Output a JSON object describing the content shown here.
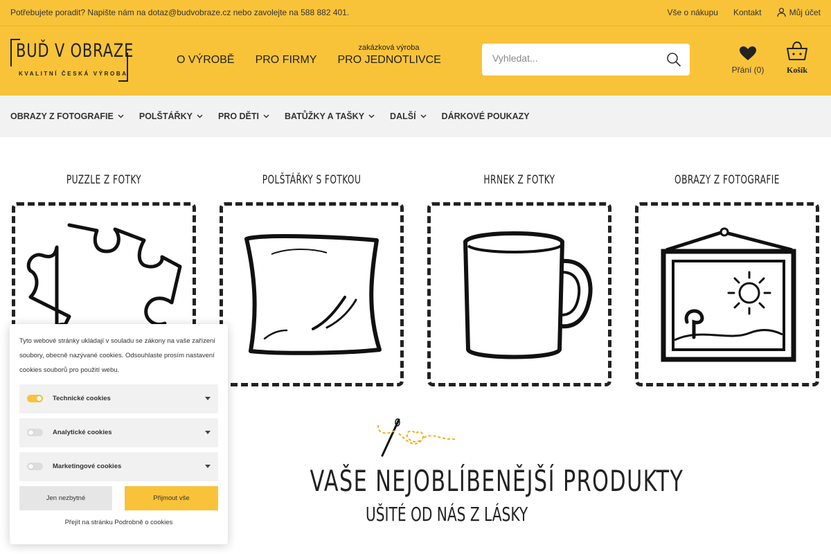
{
  "topbar": {
    "message": "Potřebujete poradit? Napište nám na dotaz@budvobraze.cz nebo zavolejte na 588 882 401.",
    "links": [
      "Vše o nákupu",
      "Kontakt"
    ],
    "account": "Můj účet"
  },
  "logo": {
    "brand": "BUĎ V OBRAZE",
    "tagline": "KVALITNÍ ČESKÁ VÝROBA"
  },
  "mainnav": {
    "items": [
      "O VÝROBĚ",
      "PRO FIRMY",
      "PRO JEDNOTLIVCE"
    ],
    "jednotlivce_small": "zakázková výroba"
  },
  "search": {
    "placeholder": "Vyhledat..."
  },
  "wishlist": {
    "label": "Přání (0)"
  },
  "cart": {
    "label": "Košík"
  },
  "catnav": {
    "items": [
      "OBRAZY Z FOTOGRAFIE",
      "POLŠTÁŘKY",
      "PRO DĚTI",
      "BATŮŽKY A TAŠKY",
      "DALŠÍ",
      "DÁRKOVÉ POUKAZY"
    ]
  },
  "cards": [
    {
      "title": "PUZZLE Z FOTKY",
      "icon": "puzzle-icon"
    },
    {
      "title": "POLŠTÁŘKY S FOTKOU",
      "icon": "pillow-icon"
    },
    {
      "title": "HRNEK Z FOTKY",
      "icon": "mug-icon"
    },
    {
      "title": "OBRAZY Z FOTOGRAFIE",
      "icon": "picture-frame-icon"
    }
  ],
  "favorites": {
    "title": "VAŠE NEJOBLÍBENĚJŠÍ PRODUKTY",
    "subtitle": "UŠITÉ OD NÁS Z LÁSKY"
  },
  "cookie": {
    "text": "Tyto webové stránky ukládají v souladu se zákony na vaše zařízení soubory, obecně nazývané cookies. Odsouhlaste prosím nastavení cookies souborů pro použití webu.",
    "categories": [
      {
        "label": "Technické cookies",
        "enabled": true
      },
      {
        "label": "Analytické cookies",
        "enabled": false
      },
      {
        "label": "Marketingové cookies",
        "enabled": false
      }
    ],
    "reject_label": "Jen nezbytné",
    "accept_label": "Přijmout vše",
    "footer": "Přejít na stránku Podrobně o cookies"
  },
  "colors": {
    "accent": "#f9c339",
    "nav_bg": "#f2f2f2",
    "text": "#222222"
  }
}
